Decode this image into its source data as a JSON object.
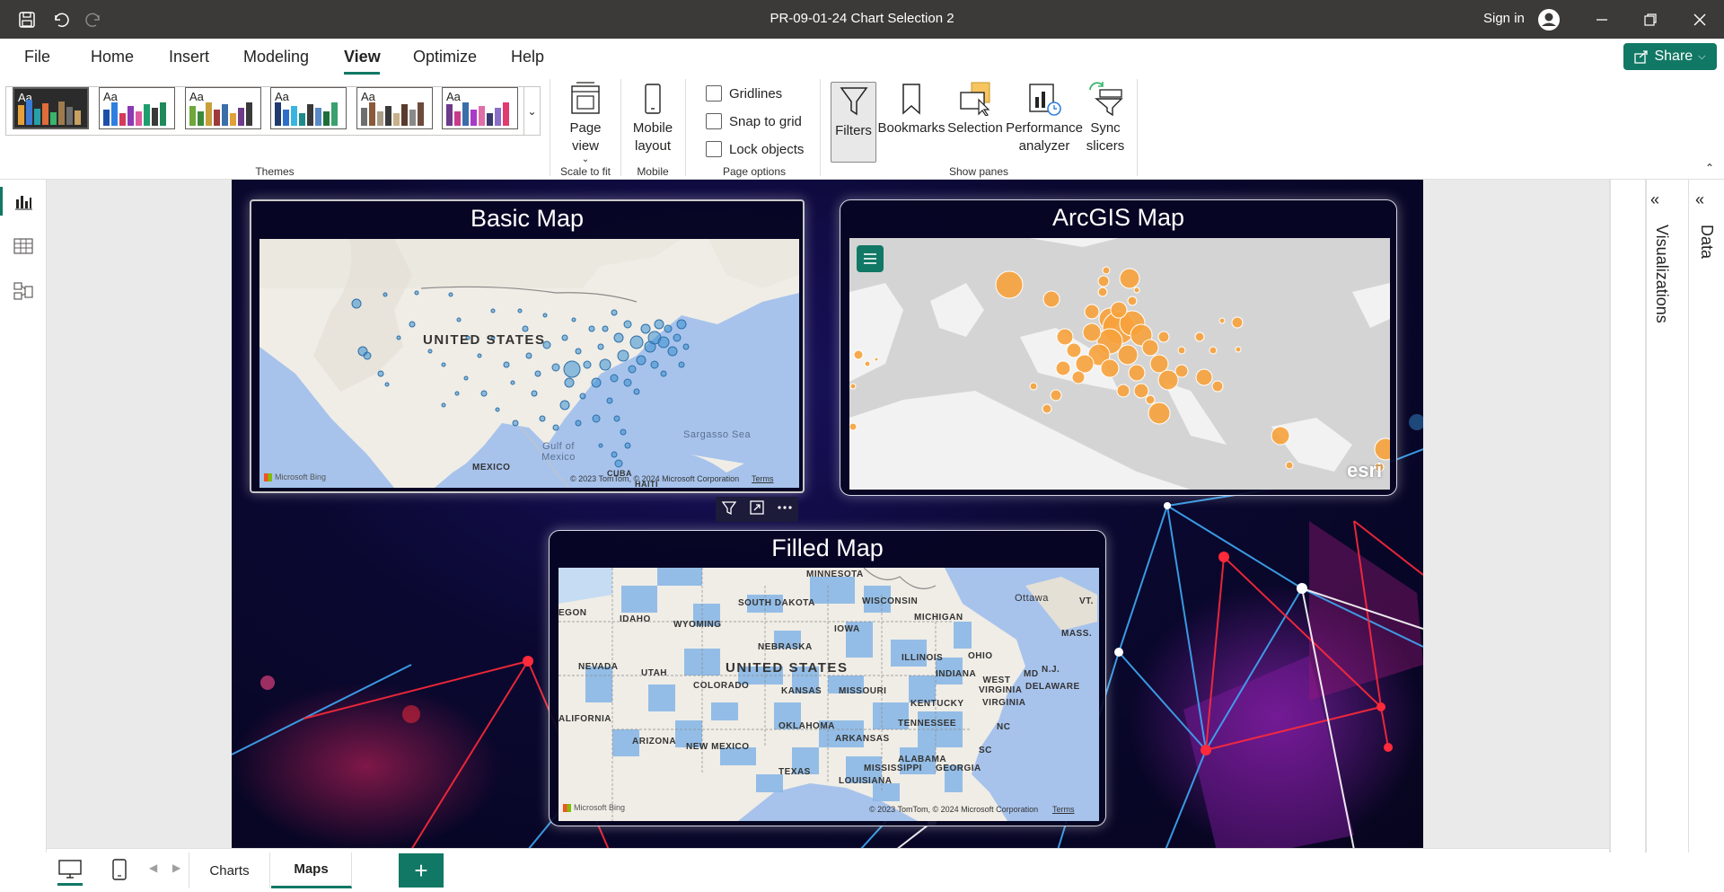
{
  "window": {
    "title": "PR-09-01-24 Chart Selection 2",
    "sign_in": "Sign in"
  },
  "menu": {
    "items": [
      "File",
      "Home",
      "Insert",
      "Modeling",
      "View",
      "Optimize",
      "Help"
    ],
    "active": "View",
    "share_label": "Share"
  },
  "ribbon": {
    "themes_label": "Themes",
    "theme_aa": "Aa",
    "page_view_label": "Page view",
    "scale_to_fit_label": "Scale to fit",
    "mobile_layout_label": "Mobile layout",
    "mobile_group_label": "Mobile",
    "gridlines_label": "Gridlines",
    "snap_to_grid_label": "Snap to grid",
    "lock_objects_label": "Lock objects",
    "page_options_label": "Page options",
    "filters_label": "Filters",
    "bookmarks_label": "Bookmarks",
    "selection_label": "Selection",
    "performance_analyzer_label": "Performance analyzer",
    "sync_slicers_label": "Sync slicers",
    "show_panes_label": "Show panes"
  },
  "visuals": {
    "basic_map": {
      "title": "Basic Map",
      "country_label": "UNITED STATES",
      "mexico_label": "MEXICO",
      "gulf_label": "Gulf of Mexico",
      "sargasso_label": "Sargasso Sea",
      "cuba_label": "CUBA",
      "haiti_label": "HAITI",
      "bing_label": "Microsoft Bing",
      "attribution": "© 2023 TomTom, © 2024 Microsoft Corporation",
      "terms": "Terms"
    },
    "arcgis_map": {
      "title": "ArcGIS Map",
      "esri_label": "esri"
    },
    "filled_map": {
      "title": "Filled Map",
      "country_label": "UNITED STATES",
      "state_labels": [
        "MINNESOTA",
        "SOUTH DAKOTA",
        "WISCONSIN",
        "IDAHO",
        "WYOMING",
        "NEBRASKA",
        "IOWA",
        "MICHIGAN",
        "NEVADA",
        "UTAH",
        "COLORADO",
        "KANSAS",
        "MISSOURI",
        "ILLINOIS",
        "INDIANA",
        "OHIO",
        "KENTUCKY",
        "WEST VIRGINIA",
        "VIRGINIA",
        "TENNESSEE",
        "NC",
        "OKLAHOMA",
        "ARKANSAS",
        "ALABAMA",
        "MISSISSIPPI",
        "GEORGIA",
        "TEXAS",
        "LOUISIANA",
        "NEW MEXICO",
        "ARIZONA",
        "ALIFORNIA",
        "EGON",
        "MD",
        "N.J.",
        "DELAWARE",
        "MASS.",
        "Ottawa",
        "VT.",
        "SC"
      ],
      "bing_label": "Microsoft Bing",
      "attribution": "© 2023 TomTom, © 2024 Microsoft Corporation",
      "terms": "Terms"
    }
  },
  "panes": {
    "visualizations_label": "Visualizations",
    "data_label": "Data"
  },
  "tabs": {
    "pages": [
      "Charts",
      "Maps"
    ],
    "active": "Maps",
    "add_label": "+"
  },
  "colors": {
    "accent": "#117865",
    "titlebar": "#3b3a39",
    "arcgis_bubble": "#f7a23b",
    "basic_bubble": "#3b8fd0",
    "filled_state": "#8ab8e6"
  }
}
